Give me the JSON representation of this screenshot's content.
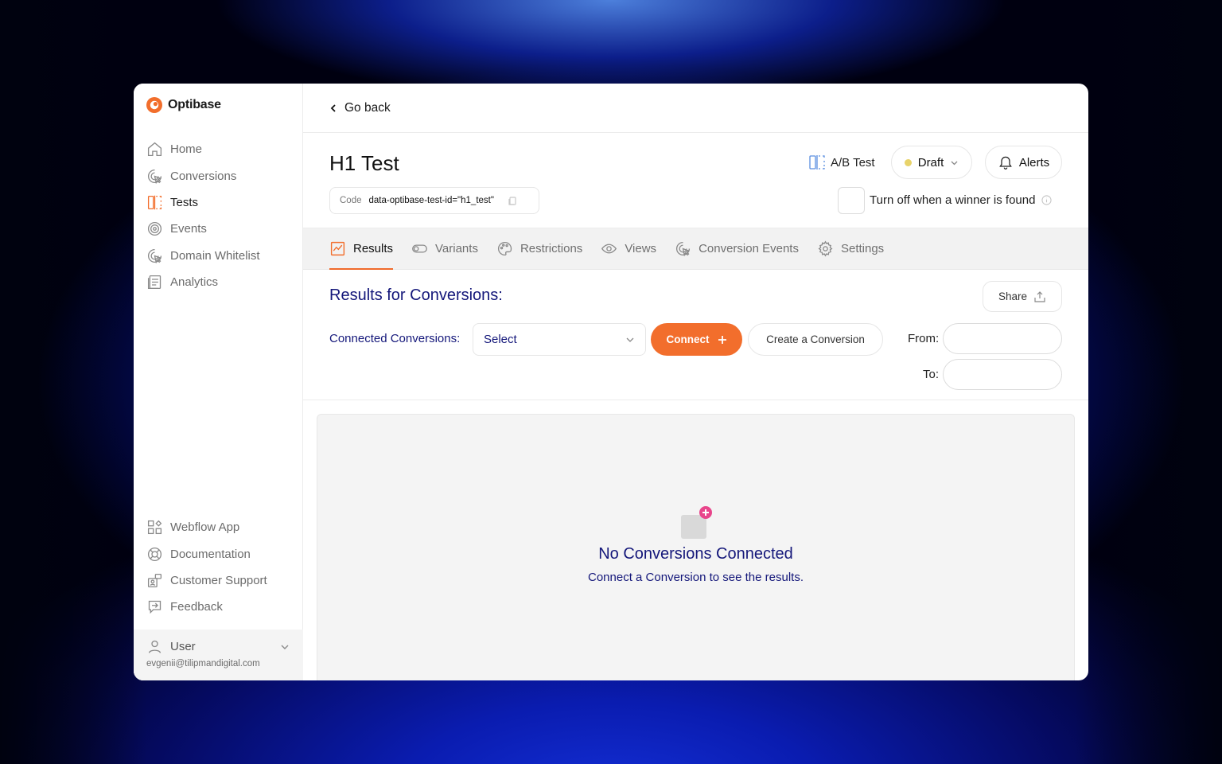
{
  "brand": {
    "name": "Optibase",
    "color": "#f26e2c"
  },
  "sidebar": {
    "items": [
      {
        "label": "Home",
        "icon": "home-icon"
      },
      {
        "label": "Conversions",
        "icon": "cursor-click-icon"
      },
      {
        "label": "Tests",
        "icon": "split-test-icon",
        "active": true
      },
      {
        "label": "Events",
        "icon": "target-icon"
      },
      {
        "label": "Domain Whitelist",
        "icon": "cursor-click-icon"
      },
      {
        "label": "Analytics",
        "icon": "report-icon"
      }
    ],
    "bottom_items": [
      {
        "label": "Webflow App",
        "icon": "apps-icon"
      },
      {
        "label": "Documentation",
        "icon": "lifebuoy-icon"
      },
      {
        "label": "Customer Support",
        "icon": "support-icon"
      },
      {
        "label": "Feedback",
        "icon": "feedback-icon"
      }
    ],
    "user": {
      "name": "User",
      "email": "evgenii@tilipmandigital.com"
    }
  },
  "topbar": {
    "back_label": "Go back"
  },
  "test": {
    "title": "H1 Test",
    "code_label": "Code",
    "code_value": "data-optibase-test-id=\"h1_test\"",
    "type_label": "A/B Test",
    "status_label": "Draft",
    "status_color": "#e8d36a",
    "alerts_label": "Alerts",
    "winner_toggle_label": "Turn off when a winner is found"
  },
  "tabs": [
    {
      "label": "Results",
      "icon": "chart-icon",
      "active": true
    },
    {
      "label": "Variants",
      "icon": "toggle-icon"
    },
    {
      "label": "Restrictions",
      "icon": "palette-icon"
    },
    {
      "label": "Views",
      "icon": "eye-icon"
    },
    {
      "label": "Conversion Events",
      "icon": "cursor-click-icon"
    },
    {
      "label": "Settings",
      "icon": "gear-icon"
    }
  ],
  "results": {
    "title": "Results for Conversions:",
    "share_label": "Share",
    "connected_label": "Connected Conversions:",
    "select_value": "Select",
    "connect_label": "Connect",
    "create_label": "Create a Conversion",
    "from_label": "From:",
    "to_label": "To:",
    "empty_title": "No Conversions Connected",
    "empty_subtitle": "Connect a Conversion to see the results."
  }
}
